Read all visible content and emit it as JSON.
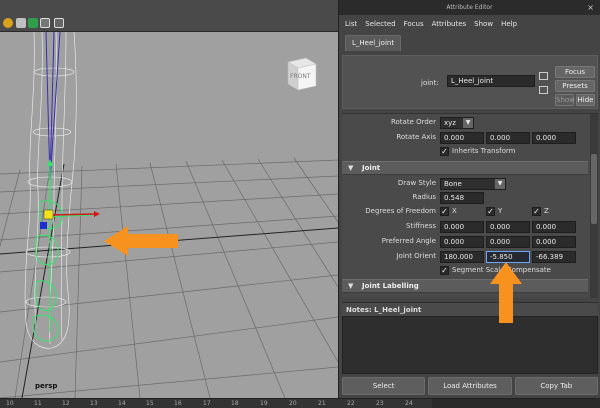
{
  "viewport": {
    "camera_label": "persp",
    "view_cube_label": "FRONT",
    "colors": {
      "background": "#a0a0a0",
      "grid": "#6a6a6a",
      "wire": "#e8e8e8",
      "selected": "#2ee86a",
      "arrow": "#f7921e"
    }
  },
  "time_ruler": {
    "ticks": [
      "10",
      "11",
      "12",
      "13",
      "14",
      "15",
      "16",
      "17",
      "18",
      "19",
      "20",
      "21",
      "22",
      "23",
      "24"
    ]
  },
  "attribute_editor": {
    "title": "Attribute Editor",
    "close_label": "×",
    "menu": [
      "List",
      "Selected",
      "Focus",
      "Attributes",
      "Show",
      "Help"
    ],
    "tab_label": "L_Heel_joint",
    "header": {
      "node_label": "joint:",
      "node_value": "L_Heel_joint",
      "focus_button": "Focus",
      "presets_button": "Presets",
      "show_button": "Show",
      "hide_button": "Hide"
    },
    "transform": {
      "rotate_order_label": "Rotate Order",
      "rotate_order_value": "xyz",
      "rotate_axis_label": "Rotate Axis",
      "rotate_axis": [
        "0.000",
        "0.000",
        "0.000"
      ],
      "inherits_transform_label": "Inherits Transform"
    },
    "joint_section": {
      "title": "Joint",
      "draw_style_label": "Draw Style",
      "draw_style_value": "Bone",
      "radius_label": "Radius",
      "radius_value": "0.548",
      "dof_label": "Degrees of Freedom",
      "dof_x": "X",
      "dof_y": "Y",
      "dof_z": "Z",
      "stiffness_label": "Stiffness",
      "stiffness": [
        "0.000",
        "0.000",
        "0.000"
      ],
      "preferred_angle_label": "Preferred Angle",
      "preferred_angle": [
        "0.000",
        "0.000",
        "0.000"
      ],
      "joint_orient_label": "Joint Orient",
      "joint_orient": [
        "180.000",
        "-5.850",
        "-66.389"
      ],
      "segment_scale_label": "Segment Scale Compensate"
    },
    "joint_labelling_title": "Joint Labelling",
    "notes_label": "Notes: L_Heel_joint",
    "buttons": {
      "select": "Select",
      "load_attributes": "Load Attributes",
      "copy_tab": "Copy Tab"
    }
  }
}
